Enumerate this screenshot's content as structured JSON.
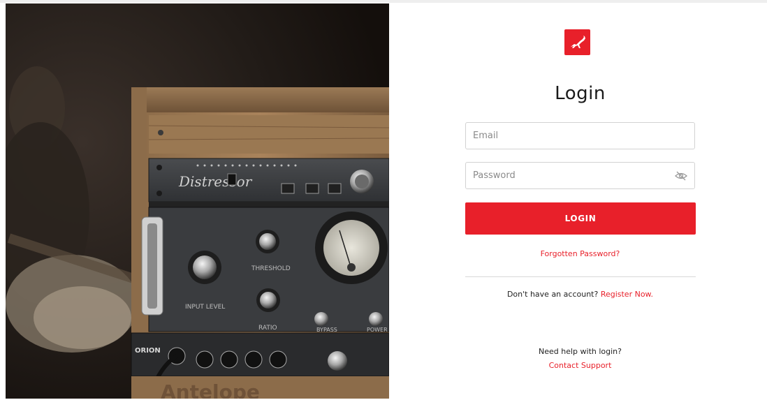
{
  "page": {
    "title": "Login"
  },
  "brand": {
    "logo_icon": "antelope-logo-icon",
    "accent_color": "#e8202a"
  },
  "form": {
    "email_placeholder": "Email",
    "password_placeholder": "Password",
    "password_toggle_icon": "eye-slash-icon",
    "login_label": "LOGIN",
    "forgot_label": "Forgotten Password?"
  },
  "register": {
    "prompt": "Don't have an account? ",
    "link_label": "Register Now."
  },
  "support": {
    "prompt": "Need help with login?",
    "link_label": "Contact Support"
  },
  "hero": {
    "alt_icon": "studio-rack-photo",
    "device_labels": {
      "compressor": "Distressor",
      "input_level": "INPUT LEVEL",
      "threshold": "THRESHOLD",
      "ratio": "RATIO",
      "bypass": "BYPASS",
      "power": "POWER",
      "brand_plate": "ORION",
      "bottom_text": "Antelope"
    }
  }
}
